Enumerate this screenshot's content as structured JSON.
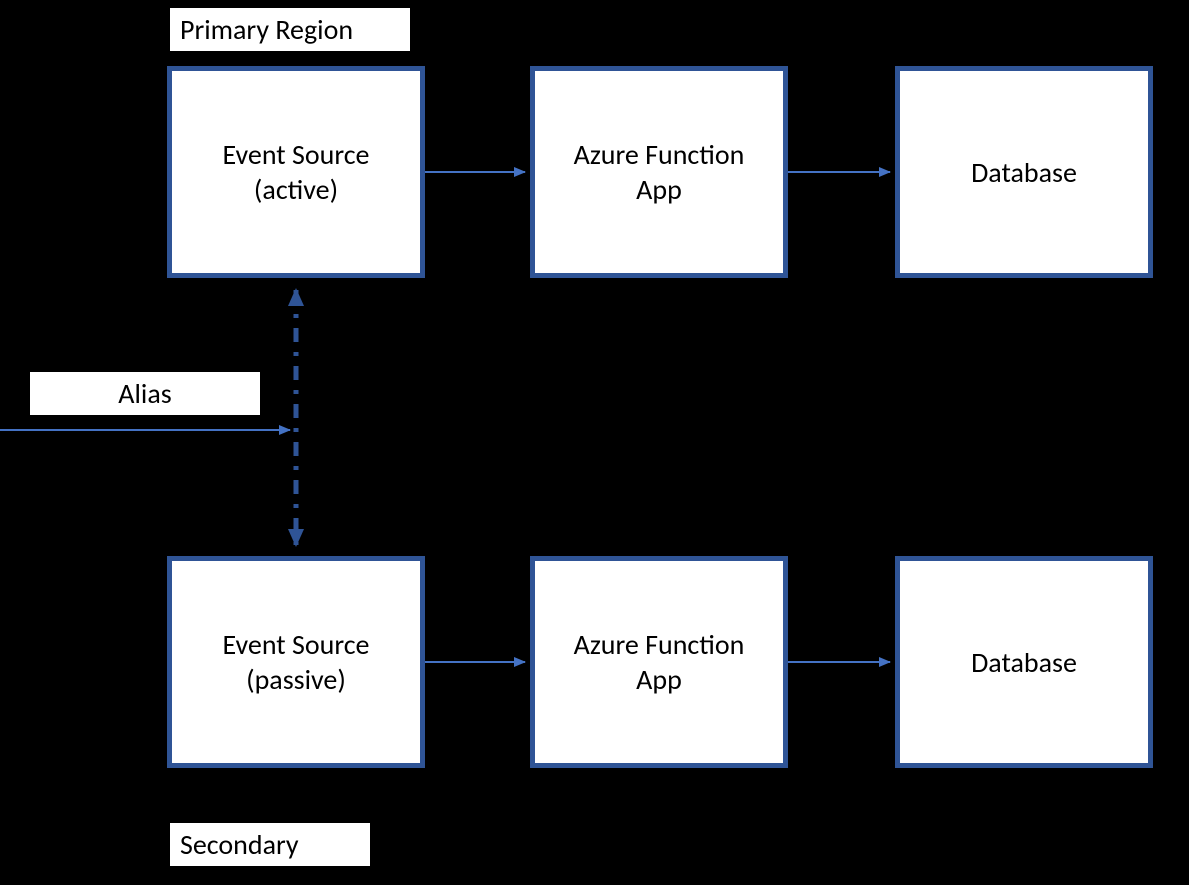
{
  "labels": {
    "primary_region": "Primary Region",
    "secondary_region": "Secondary",
    "alias": "Alias"
  },
  "nodes": {
    "primary": {
      "event_source": "Event Source\n(active)",
      "function_app": "Azure Function\nApp",
      "database": "Database"
    },
    "secondary": {
      "event_source": "Event Source\n(passive)",
      "function_app": "Azure Function\nApp",
      "database": "Database"
    }
  },
  "colors": {
    "border": "#2f5496",
    "arrow": "#4472c4"
  }
}
